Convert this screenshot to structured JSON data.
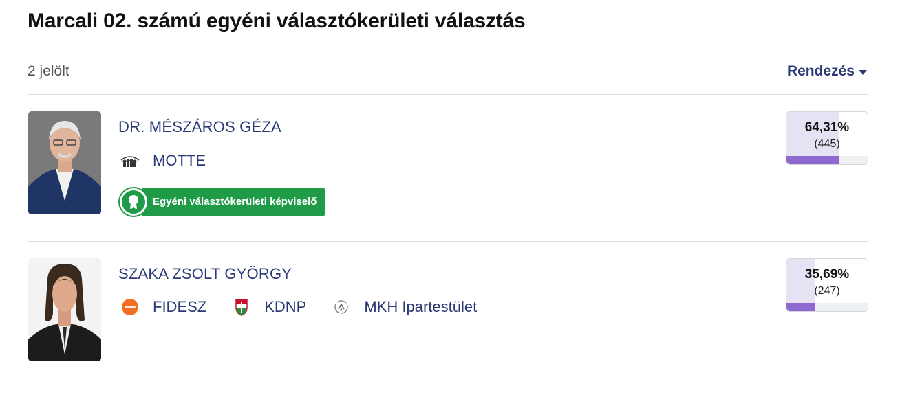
{
  "page": {
    "title": "Marcali 02. számú egyéni választókerületi választás",
    "candidate_count": "2 jelölt",
    "sort_label": "Rendezés"
  },
  "candidates": [
    {
      "name": "DR. MÉSZÁROS GÉZA",
      "parties": [
        {
          "name": "MOTTE",
          "icon": "motte-logo-icon"
        }
      ],
      "badge": "Egyéni választókerületi képviselő",
      "percent": "64,31%",
      "votes": "(445)",
      "share": 0.6431
    },
    {
      "name": "SZAKA ZSOLT GYÖRGY",
      "parties": [
        {
          "name": "FIDESZ",
          "icon": "fidesz-logo-icon"
        },
        {
          "name": "KDNP",
          "icon": "kdnp-logo-icon"
        },
        {
          "name": "MKH Ipartestület",
          "icon": "mkh-logo-icon"
        }
      ],
      "percent": "35,69%",
      "votes": "(247)",
      "share": 0.3569
    }
  ],
  "colors": {
    "accent": "#2b3a75",
    "elected_green": "#1f9a47",
    "bar_purple": "#8e6ad0",
    "fill_light": "#e6e2f3"
  }
}
